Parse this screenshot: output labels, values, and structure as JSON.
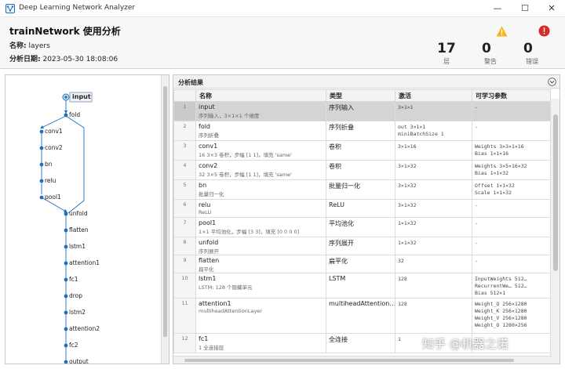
{
  "window": {
    "title": "Deep Learning Network Analyzer",
    "minimize": "—",
    "maximize": "☐",
    "close": "✕"
  },
  "header": {
    "title": "trainNetwork 使用分析",
    "name_label": "名称:",
    "name_value": "layers",
    "date_label": "分析日期:",
    "date_value": "2023-05-30 18:08:06"
  },
  "summary": {
    "layers": {
      "count": "17",
      "label": "层"
    },
    "warnings": {
      "count": "0",
      "label": "警告"
    },
    "errors": {
      "count": "0",
      "label": "错误"
    }
  },
  "graph": {
    "input_label": "input",
    "branch_nodes": [
      "conv1",
      "conv2",
      "bn",
      "relu",
      "pool1"
    ],
    "main_nodes": [
      "fold",
      "unfold",
      "flatten",
      "lstm1",
      "attention1",
      "fc1",
      "drop",
      "lstm2",
      "attention2",
      "fc2",
      "output"
    ]
  },
  "results": {
    "title": "分析结果",
    "columns": [
      "",
      "名称",
      "类型",
      "激活",
      "可学习参数"
    ],
    "rows": [
      {
        "num": "1",
        "name": "input",
        "desc": "序列输入，3×1×1 个维度",
        "type": "序列输入",
        "act": [
          "3×1×1"
        ],
        "params": [
          "-"
        ]
      },
      {
        "num": "2",
        "name": "fold",
        "desc": "序列折叠",
        "type": "序列折叠",
        "act": [
          "out          3×1×1",
          "miniBatchSize  1"
        ],
        "params": [
          "-"
        ]
      },
      {
        "num": "3",
        "name": "conv1",
        "desc": "16 3×3 卷积，步幅 [1 1]，填充 'same'",
        "type": "卷积",
        "act": [
          "3×1×16"
        ],
        "params": [
          "Weights  3×3×1×16",
          "Bias     1×1×16"
        ]
      },
      {
        "num": "4",
        "name": "conv2",
        "desc": "32 3×5 卷积，步幅 [1 1]，填充 'same'",
        "type": "卷积",
        "act": [
          "3×1×32"
        ],
        "params": [
          "Weights  3×5×16×32",
          "Bias     1×1×32"
        ]
      },
      {
        "num": "5",
        "name": "bn",
        "desc": "批量归一化",
        "type": "批量归一化",
        "act": [
          "3×1×32"
        ],
        "params": [
          "Offset  1×1×32",
          "Scale   1×1×32"
        ]
      },
      {
        "num": "6",
        "name": "relu",
        "desc": "ReLU",
        "type": "ReLU",
        "act": [
          "3×1×32"
        ],
        "params": [
          "-"
        ]
      },
      {
        "num": "7",
        "name": "pool1",
        "desc": "1×1 平均池化，步幅 [3 3]，填充 [0 0 0 0]",
        "type": "平均池化",
        "act": [
          "1×1×32"
        ],
        "params": [
          "-"
        ]
      },
      {
        "num": "8",
        "name": "unfold",
        "desc": "序列展开",
        "type": "序列展开",
        "act": [
          "1×1×32"
        ],
        "params": [
          "-"
        ]
      },
      {
        "num": "9",
        "name": "flatten",
        "desc": "扁平化",
        "type": "扁平化",
        "act": [
          "32"
        ],
        "params": [
          "-"
        ]
      },
      {
        "num": "10",
        "name": "lstm1",
        "desc": "LSTM: 128 个隐藏单元",
        "type": "LSTM",
        "act": [
          "128"
        ],
        "params": [
          "InputWeights     512…",
          "RecurrentWe…     512…",
          "Bias             512×1"
        ]
      },
      {
        "num": "11",
        "name": "attention1",
        "desc": "multiheadAttentionLayer",
        "type": "multiheadAttention…",
        "act": [
          "128"
        ],
        "params": [
          "Weight_Q  256×1280",
          "Weight_K  256×1280",
          "Weight_V  256×1280",
          "Weight_O  1280×256"
        ]
      },
      {
        "num": "12",
        "name": "fc1",
        "desc": "1 全连接层",
        "type": "全连接",
        "act": [
          "1"
        ],
        "params": [
          "-"
        ]
      }
    ]
  },
  "watermark": "知乎 @机器之诺",
  "colors": {
    "accent_blue": "#1f6fbf",
    "warning_yellow": "#f2b51b",
    "error_red": "#d42b2b",
    "selected_row": "#d4d4d4"
  },
  "icons": {
    "app": "network-analyzer-icon",
    "warning": "warning-triangle-icon",
    "error": "error-circle-icon",
    "collapse": "chevron-down-circle-icon"
  }
}
